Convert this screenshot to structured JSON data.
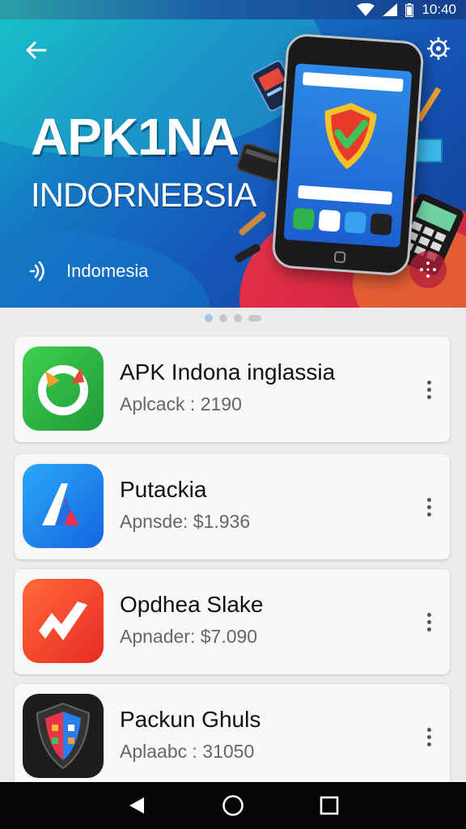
{
  "status_bar": {
    "time": "10:40",
    "icons": [
      "wifi-icon",
      "signal-icon",
      "battery-icon"
    ]
  },
  "hero": {
    "title": "APK1NA",
    "subtitle": "INDORNEBSIA",
    "location_label": "Indomesia",
    "icons": [
      "back-arrow-icon",
      "settings-gear-icon",
      "wireless-icon",
      "share-icon"
    ],
    "colors": {
      "primary": "#1556b8",
      "accent_teal": "#0fb5c4",
      "accent_red": "#e8334a"
    }
  },
  "pager": {
    "pages": 4,
    "active_index": 0
  },
  "apps": [
    {
      "name": "APK Indona inglassia",
      "meta": "Aplcack : 2190",
      "icon": "green-app-icon",
      "color": "#2fb24a"
    },
    {
      "name": "Putackia",
      "meta": "Apnsde: $1.936",
      "icon": "blue-letter-a-icon",
      "color": "#1e8ef0"
    },
    {
      "name": "Opdhea Slake",
      "meta": "Apnader: $7.090",
      "icon": "red-chart-icon",
      "color": "#f0432c"
    },
    {
      "name": "Packun Ghuls",
      "meta": "Aplaabc : 31050",
      "icon": "dark-shield-icon",
      "color": "#222222"
    }
  ],
  "nav_bar": {
    "icons": [
      "back-triangle-icon",
      "home-circle-icon",
      "recents-square-icon"
    ]
  }
}
